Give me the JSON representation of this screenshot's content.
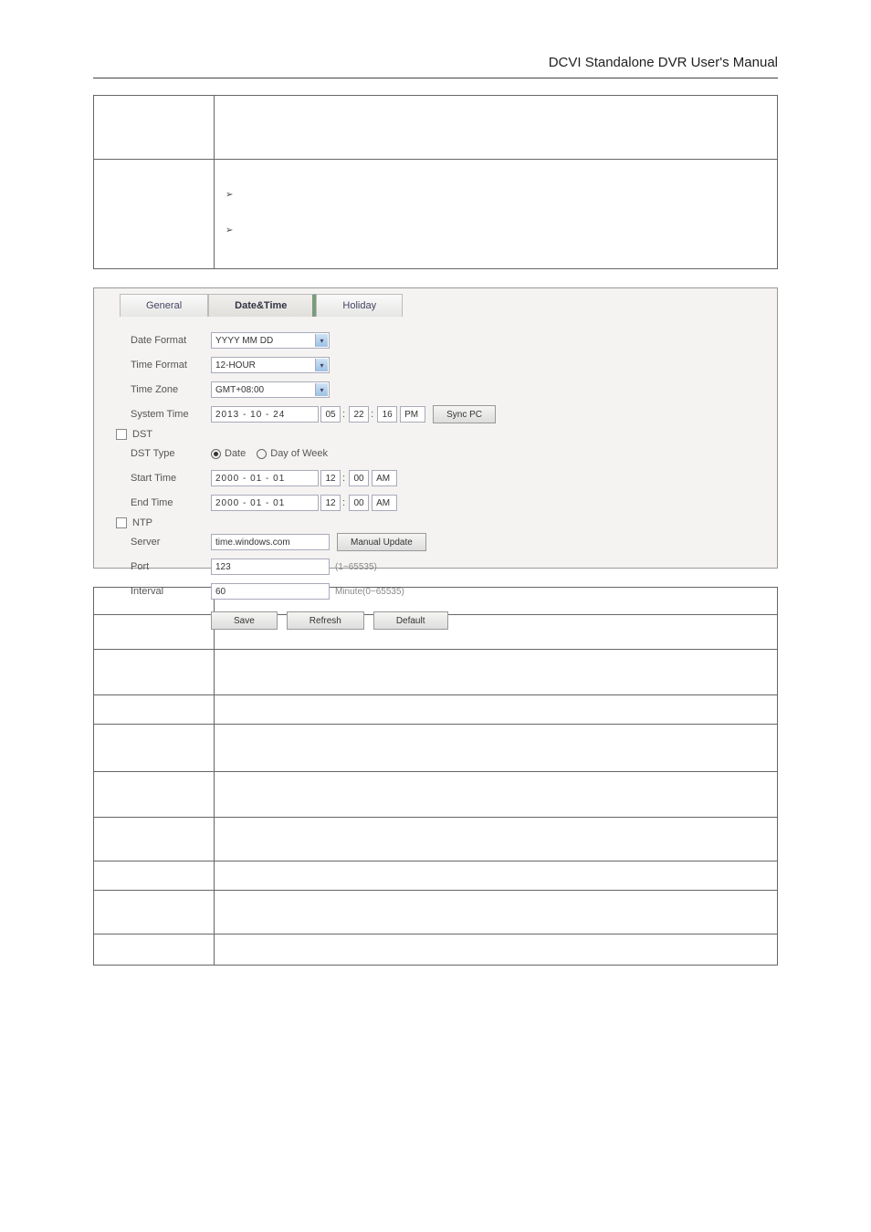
{
  "docTitle": "DCVI Standalone DVR User's Manual",
  "topTable": {
    "row1": {
      "label": " ",
      "desc": " "
    },
    "row2": {
      "label": " ",
      "desc": " ",
      "bullet1": " ",
      "bullet2": " "
    }
  },
  "screenshot": {
    "tabs": {
      "general": "General",
      "dateTime": "Date&Time",
      "holiday": "Holiday"
    },
    "labels": {
      "dateFormat": "Date Format",
      "timeFormat": "Time Format",
      "timeZone": "Time Zone",
      "systemTime": "System Time",
      "dst": "DST",
      "dstType": "DST Type",
      "startTime": "Start Time",
      "endTime": "End Time",
      "ntp": "NTP",
      "server": "Server",
      "port": "Port",
      "interval": "Interval"
    },
    "values": {
      "dateFormat": "YYYY MM DD",
      "timeFormat": "12-HOUR",
      "timeZone": "GMT+08:00",
      "sysDate": "2013 - 10 - 24",
      "sysH": "05",
      "sysM": "22",
      "sysS": "16",
      "sysAP": "PM",
      "syncPc": "Sync PC",
      "radioDate": "Date",
      "radioDow": "Day of Week",
      "startDate": "2000 - 01 - 01",
      "startH": "12",
      "startM": "00",
      "startAP": "AM",
      "endDate": "2000 - 01 - 01",
      "endH": "12",
      "endM": "00",
      "endAP": "AM",
      "server": "time.windows.com",
      "manualUpdate": "Manual Update",
      "port": "123",
      "portHint": "(1~65535)",
      "interval": "60",
      "intervalHint": "Minute(0~65535)"
    },
    "buttons": {
      "save": "Save",
      "refresh": "Refresh",
      "default": "Default"
    }
  },
  "figureCaption": " ",
  "paramIntro": " ",
  "paramTable": {
    "hParam": " ",
    "hFunc": " ",
    "rows": [
      {
        "p": " ",
        "f": " "
      },
      {
        "p": " ",
        "f": " "
      },
      {
        "p": " ",
        "f": " "
      },
      {
        "p": " ",
        "f": " "
      },
      {
        "p": " ",
        "f": " "
      },
      {
        "p": " ",
        "f": " "
      },
      {
        "p": " ",
        "f": " "
      },
      {
        "p": " ",
        "f": " "
      },
      {
        "p": " ",
        "f": " "
      }
    ]
  }
}
